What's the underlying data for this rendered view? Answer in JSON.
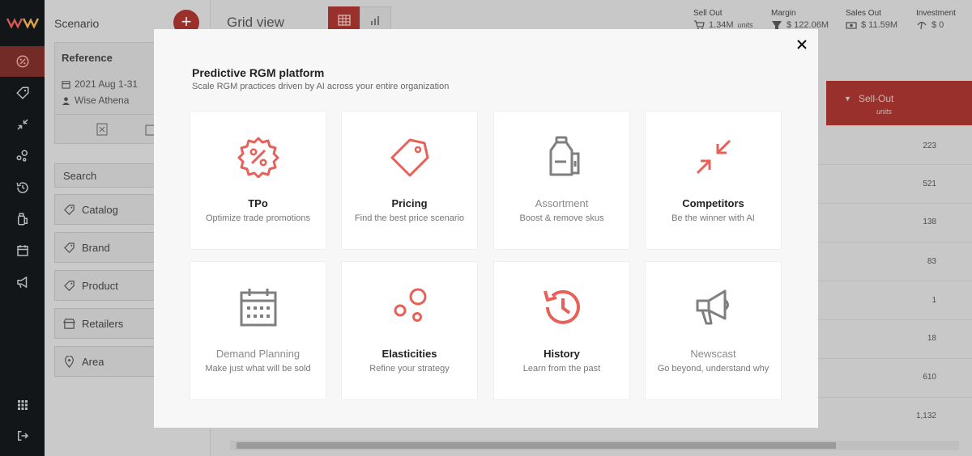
{
  "colors": {
    "accent": "#e8605a",
    "gray_icon": "#7f7f7f",
    "rail_bg": "#14181c",
    "header_red": "#a6352f"
  },
  "rail": {
    "items": [
      {
        "name": "tpo-icon",
        "active": true
      },
      {
        "name": "pricing-tag-icon"
      },
      {
        "name": "competitors-arrows-icon"
      },
      {
        "name": "elasticities-circles-icon"
      },
      {
        "name": "history-icon"
      },
      {
        "name": "assortment-bottle-icon"
      },
      {
        "name": "calendar-icon"
      },
      {
        "name": "megaphone-icon"
      },
      {
        "name": "apps-grid-icon"
      },
      {
        "name": "logout-icon"
      }
    ]
  },
  "panel": {
    "title": "Scenario",
    "add_label": "+",
    "reference": {
      "title": "Reference",
      "date": "2021 Aug 1-31",
      "user": "Wise Athena"
    },
    "search_label": "Search",
    "filters": [
      {
        "label": "Catalog",
        "icon": "tag-icon"
      },
      {
        "label": "Brand",
        "icon": "tag-icon"
      },
      {
        "label": "Product",
        "icon": "tag-icon"
      },
      {
        "label": "Retailers",
        "icon": "store-icon"
      },
      {
        "label": "Area",
        "icon": "location-pin-icon"
      }
    ]
  },
  "main": {
    "title": "Grid view",
    "kpis": [
      {
        "label": "Sell Out",
        "value": "1.34M",
        "unit": "units",
        "icon": "cart-icon"
      },
      {
        "label": "Margin",
        "value": "$ 122.06M",
        "icon": "margin-icon"
      },
      {
        "label": "Sales Out",
        "value": "$ 11.59M",
        "icon": "money-icon"
      },
      {
        "label": "Investment",
        "value": "$ 0",
        "icon": "investment-icon"
      }
    ],
    "column": {
      "label": "Sell-Out",
      "sub": "units"
    },
    "cells": [
      "223",
      "521",
      "138",
      "83",
      "1",
      "18",
      "610",
      "1,132"
    ]
  },
  "modal": {
    "title": "Predictive RGM platform",
    "subtitle": "Scale RGM practices driven by AI across your entire organization",
    "cards": [
      {
        "title": "TPo",
        "desc": "Optimize trade promotions",
        "icon": "tpo-badge-icon",
        "muted": false
      },
      {
        "title": "Pricing",
        "desc": "Find the best price scenario",
        "icon": "price-tag-icon",
        "muted": false
      },
      {
        "title": "Assortment",
        "desc": "Boost & remove skus",
        "icon": "bottle-icon",
        "muted": true
      },
      {
        "title": "Competitors",
        "desc": "Be the winner with AI",
        "icon": "arrows-inward-icon",
        "muted": false
      },
      {
        "title": "Demand Planning",
        "desc": "Make just what will be sold",
        "icon": "calendar-icon",
        "muted": true
      },
      {
        "title": "Elasticities",
        "desc": "Refine your strategy",
        "icon": "circles-icon",
        "muted": false
      },
      {
        "title": "History",
        "desc": "Learn from the past",
        "icon": "history-icon",
        "muted": false
      },
      {
        "title": "Newscast",
        "desc": "Go beyond, understand why",
        "icon": "megaphone-icon",
        "muted": true
      }
    ]
  }
}
